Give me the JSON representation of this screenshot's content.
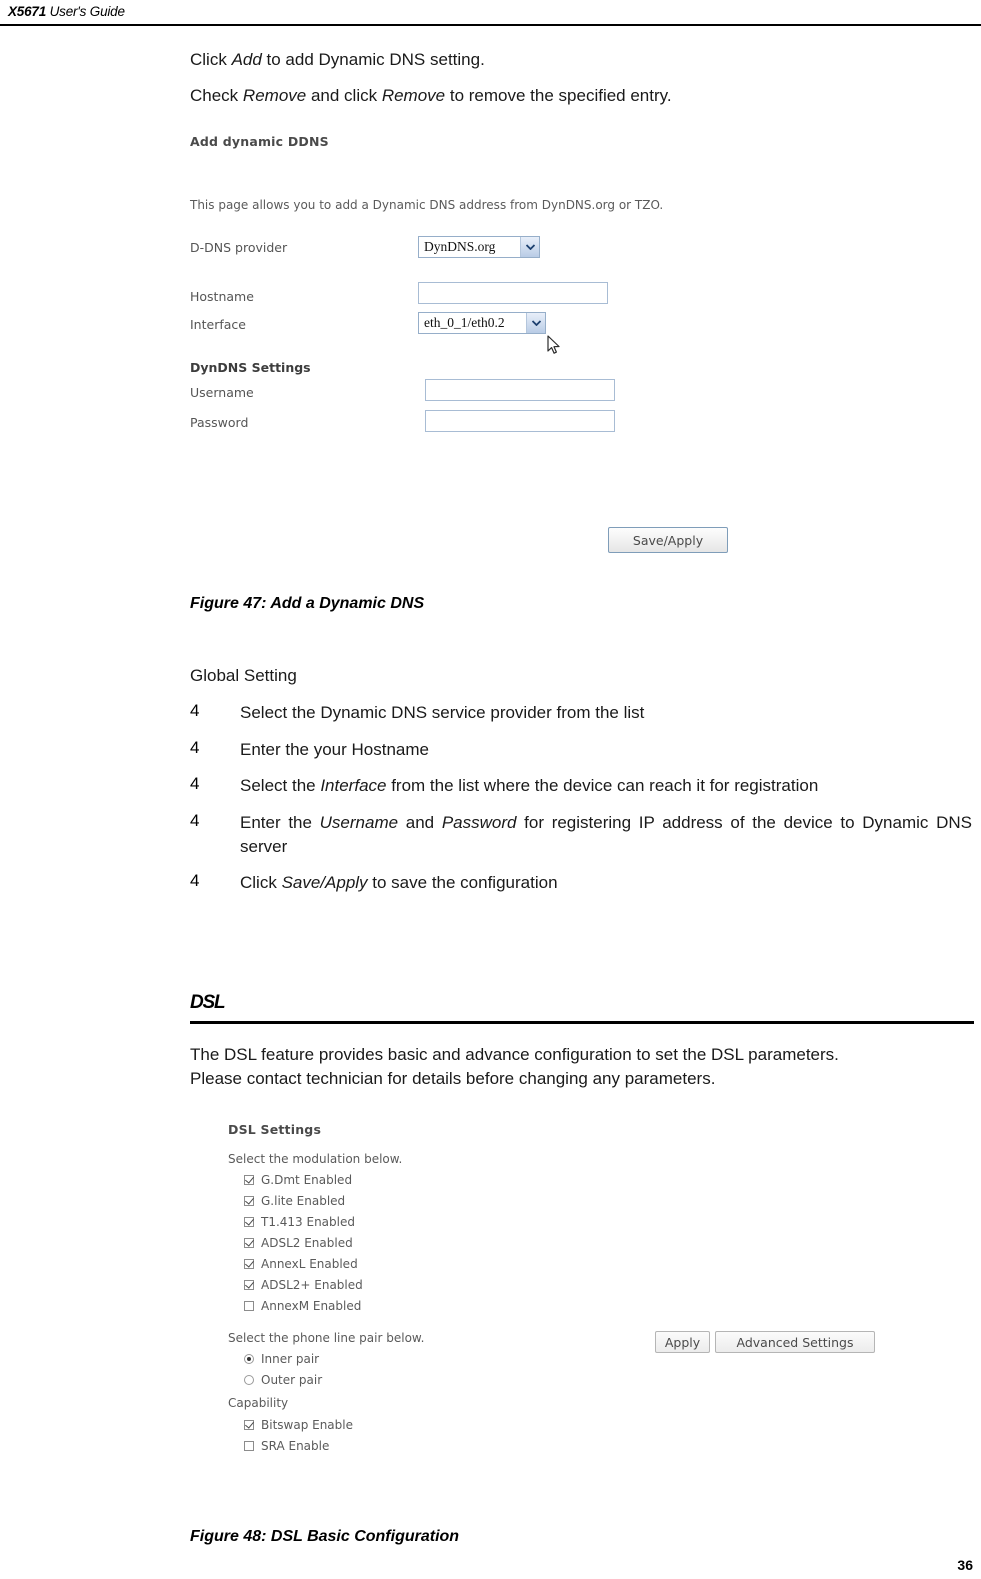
{
  "header": {
    "model": "X5671",
    "title": " User's Guide"
  },
  "intro": {
    "line1_pre": "Click ",
    "line1_em": "Add",
    "line1_post": " to add Dynamic DNS setting.",
    "line2_pre": "Check ",
    "line2_em1": "Remove",
    "line2_mid": " and click ",
    "line2_em2": "Remove",
    "line2_post": " to remove the specified entry."
  },
  "ddns_screenshot": {
    "title": "Add dynamic DDNS",
    "description": "This page allows you to add a Dynamic DNS address from DynDNS.org or TZO.",
    "provider_label": "D-DNS provider",
    "provider_value": "DynDNS.org",
    "hostname_label": "Hostname",
    "hostname_value": "",
    "interface_label": "Interface",
    "interface_value": "eth_0_1/eth0.2",
    "settings_heading": "DynDNS Settings",
    "username_label": "Username",
    "username_value": "",
    "password_label": "Password",
    "password_value": "",
    "save_button": "Save/Apply"
  },
  "figure47": {
    "caption": "Figure 47: Add a Dynamic DNS"
  },
  "global_setting": {
    "heading": "Global Setting",
    "bullet_marker": "4",
    "items": [
      {
        "parts": [
          {
            "text": "Select the Dynamic DNS service provider from the list",
            "em": false
          }
        ]
      },
      {
        "parts": [
          {
            "text": "Enter the your Hostname",
            "em": false
          }
        ]
      },
      {
        "parts": [
          {
            "text": "Select the ",
            "em": false
          },
          {
            "text": "Interface",
            "em": true
          },
          {
            "text": " from the list where the device can reach it for registration",
            "em": false
          }
        ]
      },
      {
        "parts": [
          {
            "text": "Enter the ",
            "em": false
          },
          {
            "text": "Username",
            "em": true
          },
          {
            "text": " and ",
            "em": false
          },
          {
            "text": "Password",
            "em": true
          },
          {
            "text": " for registering IP address of the device to Dynamic DNS server",
            "em": false
          }
        ]
      },
      {
        "parts": [
          {
            "text": "Click ",
            "em": false
          },
          {
            "text": "Save/Apply",
            "em": true
          },
          {
            "text": " to save the configuration",
            "em": false
          }
        ]
      }
    ]
  },
  "dsl_section": {
    "heading": "DSL",
    "paragraph_line1": "The DSL feature provides basic and advance configuration to set the DSL parameters.",
    "paragraph_line2": "Please contact technician for details before changing any parameters."
  },
  "dsl_screenshot": {
    "title": "DSL Settings",
    "modulation_prompt": "Select the modulation below.",
    "modulation_options": [
      {
        "label": "G.Dmt Enabled",
        "checked": true
      },
      {
        "label": "G.lite Enabled",
        "checked": true
      },
      {
        "label": "T1.413 Enabled",
        "checked": true
      },
      {
        "label": "ADSL2 Enabled",
        "checked": true
      },
      {
        "label": "AnnexL Enabled",
        "checked": true
      },
      {
        "label": "ADSL2+ Enabled",
        "checked": true
      },
      {
        "label": "AnnexM Enabled",
        "checked": false
      }
    ],
    "linepair_prompt": "Select the phone line pair below.",
    "linepair_options": [
      {
        "label": "Inner pair",
        "selected": true
      },
      {
        "label": "Outer pair",
        "selected": false
      }
    ],
    "capability_prompt": "Capability",
    "capability_options": [
      {
        "label": "Bitswap Enable",
        "checked": true
      },
      {
        "label": "SRA Enable",
        "checked": false
      }
    ],
    "apply_button": "Apply",
    "advanced_button": "Advanced Settings"
  },
  "figure48": {
    "caption": "Figure 48: DSL Basic Configuration"
  },
  "footer": {
    "page_number": "36"
  }
}
